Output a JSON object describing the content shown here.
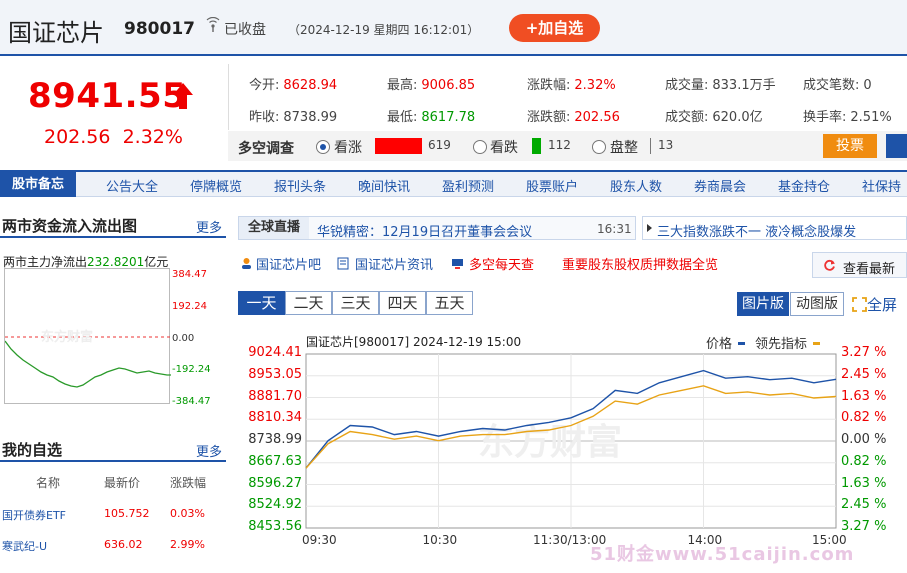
{
  "header": {
    "name": "国证芯片",
    "code": "980017",
    "status": "已收盘",
    "datetime": "（2024-12-19 星期四 16:12:01）",
    "add_label": "+加自选"
  },
  "quote": {
    "price": "8941.55",
    "change": "202.56",
    "change_pct": "2.32%",
    "fields": [
      {
        "label": "今开:",
        "value": "8628.94",
        "color": "red"
      },
      {
        "label": "最高:",
        "value": "9006.85",
        "color": "red"
      },
      {
        "label": "涨跌幅:",
        "value": "2.32%",
        "color": "red"
      },
      {
        "label": "成交量:",
        "value": "833.1万手",
        "color": ""
      },
      {
        "label": "成交笔数:",
        "value": "0",
        "color": ""
      },
      {
        "label": "昨收:",
        "value": "8738.99",
        "color": ""
      },
      {
        "label": "最低:",
        "value": "8617.78",
        "color": "green"
      },
      {
        "label": "涨跌额:",
        "value": "202.56",
        "color": "red"
      },
      {
        "label": "成交额:",
        "value": "620.0亿",
        "color": ""
      },
      {
        "label": "换手率:",
        "value": "2.51%",
        "color": ""
      }
    ]
  },
  "poll": {
    "title": "多空调查",
    "bull_label": "看涨",
    "bull_count": "619",
    "bear_label": "看跌",
    "bear_count": "112",
    "flat_label": "盘整",
    "flat_count": "13",
    "vote_label": "投票",
    "bull_color": "#ff0000",
    "bear_color": "#00aa00"
  },
  "nav": [
    "股市备忘",
    "公告大全",
    "停牌概览",
    "报刊头条",
    "晚间快讯",
    "盈利预测",
    "股票账户",
    "股东人数",
    "券商晨会",
    "基金持仓",
    "社保持"
  ],
  "flow": {
    "title": "两市资金流入流出图",
    "more": "更多",
    "label": "两市主力净流出",
    "value": "232.8201",
    "unit": "亿元",
    "ticks": [
      "384.47",
      "192.24",
      "0.00",
      "-192.24",
      "-384.47"
    ]
  },
  "watchlist": {
    "title": "我的自选",
    "more": "更多",
    "headers": [
      "名称",
      "最新价",
      "涨跌幅"
    ],
    "rows": [
      {
        "name": "国开债券ETF",
        "price": "105.752",
        "pct": "0.03%"
      },
      {
        "name": "寒武纪-U",
        "price": "636.02",
        "pct": "2.99%"
      }
    ]
  },
  "live": {
    "title": "全球直播",
    "news": "华锐精密：12月19日召开董事会会议",
    "time": "16:31",
    "news2": "三大指数涨跌不一  液冷概念股爆发"
  },
  "links": [
    "国证芯片吧",
    "国证芯片资讯",
    "多空每天查",
    "重要股东股权质押数据全览"
  ],
  "refresh_label": "查看最新",
  "day_tabs": [
    "一天",
    "二天",
    "三天",
    "四天",
    "五天"
  ],
  "view_tabs": [
    "图片版",
    "动图版"
  ],
  "fullscreen": "全屏",
  "chart": {
    "title": "国证芯片[980017] 2024-12-19 15:00",
    "legend_price": "价格",
    "legend_lead": "领先指标",
    "price_color": "#1e53a8",
    "lead_color": "#e8a316",
    "left_ticks": [
      "9024.41",
      "8953.05",
      "8881.70",
      "8810.34",
      "8738.99",
      "8667.63",
      "8596.27",
      "8524.92",
      "8453.56"
    ],
    "right_ticks": [
      "3.27 %",
      "2.45 %",
      "1.63 %",
      "0.82 %",
      "0.00 %",
      "0.82 %",
      "1.63 %",
      "2.45 %",
      "3.27 %"
    ],
    "x_ticks": [
      "09:30",
      "10:30",
      "11:30/13:00",
      "14:00",
      "15:00"
    ]
  },
  "chart_data": {
    "type": "line",
    "title": "国证芯片[980017] 2024-12-19 15:00",
    "x": [
      "09:30",
      "09:40",
      "09:50",
      "10:00",
      "10:10",
      "10:20",
      "10:30",
      "10:40",
      "10:50",
      "11:00",
      "11:10",
      "11:20",
      "11:30/13:00",
      "13:10",
      "13:20",
      "13:30",
      "13:40",
      "13:50",
      "14:00",
      "14:10",
      "14:20",
      "14:30",
      "14:40",
      "14:50",
      "15:00"
    ],
    "series": [
      {
        "name": "价格",
        "values": [
          8650,
          8740,
          8790,
          8785,
          8760,
          8770,
          8755,
          8770,
          8780,
          8775,
          8790,
          8800,
          8815,
          8845,
          8905,
          8895,
          8930,
          8950,
          8970,
          8945,
          8950,
          8940,
          8945,
          8930,
          8941.55
        ]
      },
      {
        "name": "领先指标",
        "values": [
          8650,
          8730,
          8770,
          8760,
          8745,
          8755,
          8740,
          8755,
          8760,
          8760,
          8770,
          8775,
          8790,
          8820,
          8870,
          8860,
          8890,
          8905,
          8920,
          8895,
          8900,
          8890,
          8895,
          8880,
          8885
        ]
      }
    ],
    "ylim": [
      8453.56,
      9024.41
    ]
  },
  "watermark": "51财金www.51caijin.com"
}
